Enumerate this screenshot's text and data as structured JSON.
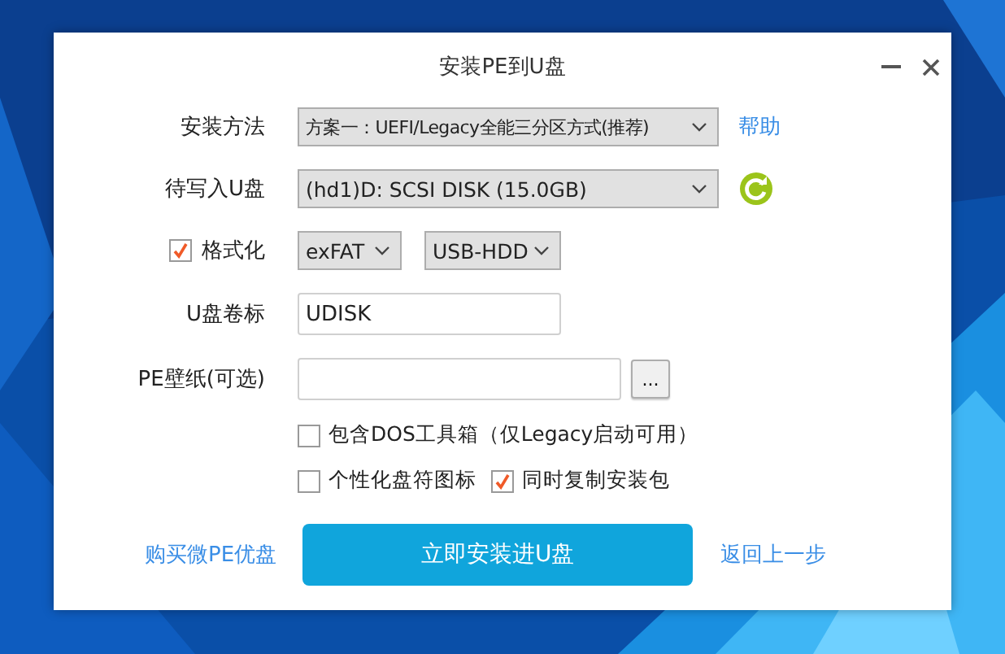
{
  "window": {
    "title": "安装PE到U盘"
  },
  "install_method": {
    "label": "安装方法",
    "value": "方案一：UEFI/Legacy全能三分区方式(推荐)",
    "help": "帮助"
  },
  "target_disk": {
    "label": "待写入U盘",
    "value": "(hd1)D: SCSI DISK (15.0GB)"
  },
  "format": {
    "label": "格式化",
    "checked": true,
    "filesystem": "exFAT",
    "mode": "USB-HDD"
  },
  "volume_label": {
    "label": "U盘卷标",
    "value": "UDISK"
  },
  "wallpaper": {
    "label": "PE壁纸(可选)",
    "browse": "..."
  },
  "options": [
    {
      "label": "包含DOS工具箱（仅Legacy启动可用）",
      "checked": false
    },
    {
      "label": "个性化盘符图标",
      "checked": false
    },
    {
      "label": "同时复制安装包",
      "checked": true
    }
  ],
  "footer": {
    "buy_link": "购买微PE优盘",
    "install_button": "立即安装进U盘",
    "back_link": "返回上一步"
  }
}
